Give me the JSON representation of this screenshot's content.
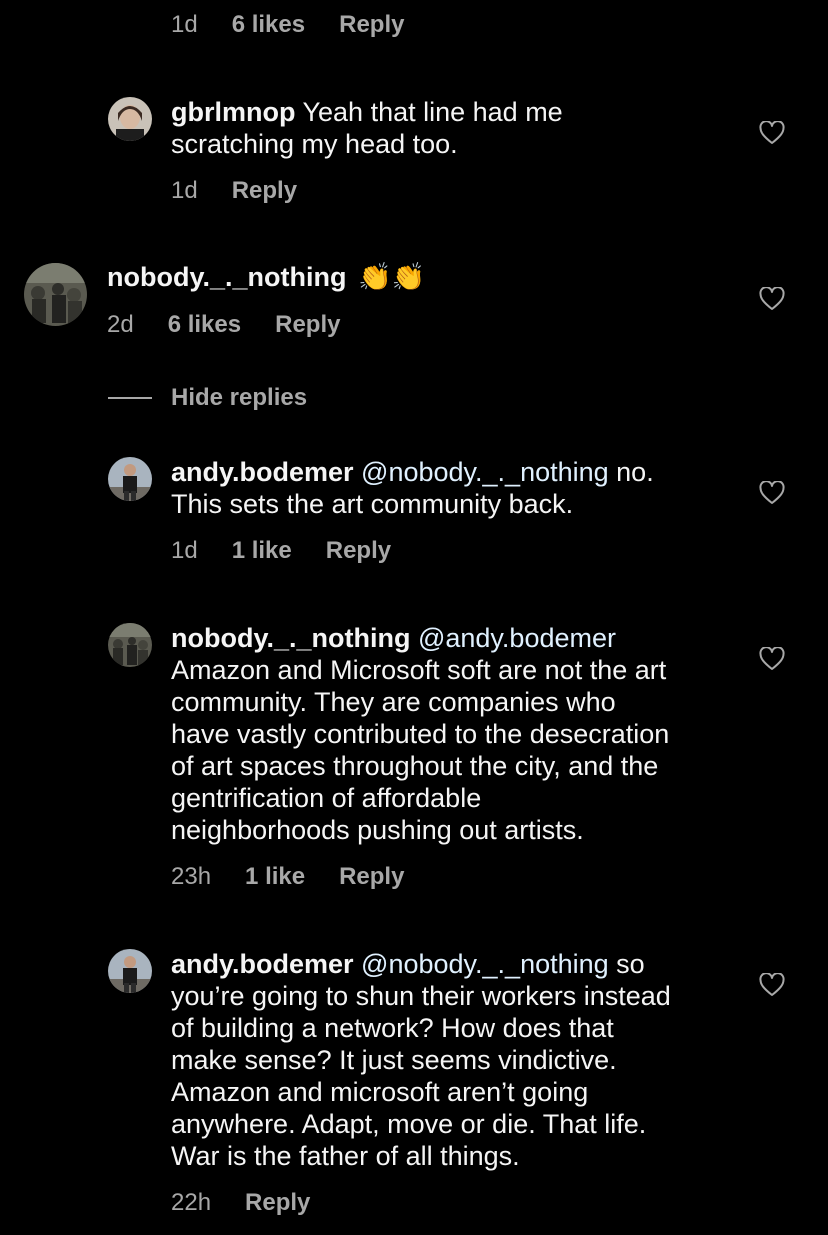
{
  "top_meta": {
    "time": "1d",
    "likes": "6 likes",
    "reply": "Reply"
  },
  "comments": [
    {
      "username": "gbrlmnop",
      "lines": [
        " Yeah that line had me",
        "scratching my head too."
      ],
      "time": "1d",
      "reply": "Reply"
    },
    {
      "username": "nobody._._nothing",
      "emoji": "👏👏",
      "time": "2d",
      "likes": "6 likes",
      "reply": "Reply"
    },
    {
      "username": "andy.bodemer",
      "mention": " @nobody._._nothing",
      "lines": [
        " no.",
        "This sets the art community back."
      ],
      "time": "1d",
      "likes": "1 like",
      "reply": "Reply"
    },
    {
      "username": "nobody._._nothing",
      "mention": " @andy.bodemer",
      "lines": [
        "Amazon and Microsoft soft are not the art",
        "community. They are  companies who",
        "have vastly contributed to the desecration",
        "of art spaces throughout the city, and the",
        "gentrification of affordable",
        "neighborhoods pushing out artists."
      ],
      "time": "23h",
      "likes": "1 like",
      "reply": "Reply"
    },
    {
      "username": "andy.bodemer",
      "mention": " @nobody._._nothing",
      "lines": [
        " so",
        "you’re going to shun their workers instead",
        "of building a network? How does that",
        "make sense? It just seems vindictive.",
        "Amazon and microsoft aren’t going",
        "anywhere. Adapt, move or die. That life.",
        "War is the father of all things."
      ],
      "time": "22h",
      "reply": "Reply"
    }
  ],
  "hide_replies": "Hide replies",
  "icons": {
    "heart": "heart-icon"
  },
  "colors": {
    "background": "#000000",
    "text": "#f5f5f5",
    "secondary": "#a8a8a8",
    "mention": "#e0f1ff"
  }
}
